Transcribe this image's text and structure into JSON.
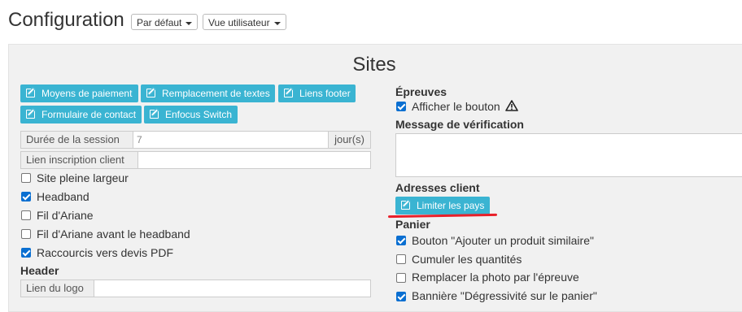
{
  "header": {
    "title": "Configuration",
    "dropdown_default": "Par défaut",
    "dropdown_user": "Vue utilisateur"
  },
  "panel": {
    "title": "Sites"
  },
  "buttons": [
    "Moyens de paiement",
    "Remplacement de textes",
    "Liens footer",
    "Formulaire de contact",
    "Enfocus Switch"
  ],
  "session": {
    "label": "Durée de la session",
    "value": "7",
    "unit": "jour(s)"
  },
  "inscription": {
    "label": "Lien inscription client",
    "value": ""
  },
  "left_checkboxes": [
    {
      "label": "Site pleine largeur",
      "checked": false
    },
    {
      "label": "Headband",
      "checked": true
    },
    {
      "label": "Fil d'Ariane",
      "checked": false
    },
    {
      "label": "Fil d'Ariane avant le headband",
      "checked": false
    },
    {
      "label": "Raccourcis vers devis PDF",
      "checked": true
    }
  ],
  "header_section": {
    "title": "Header",
    "logo_label": "Lien du logo",
    "logo_value": ""
  },
  "epreuves": {
    "title": "Épreuves",
    "show_button_label": "Afficher le bouton",
    "show_button_checked": true,
    "warning_icon": "warning-icon"
  },
  "message": {
    "title": "Message de vérification",
    "value": ""
  },
  "adresses": {
    "title": "Adresses client",
    "button": "Limiter les pays"
  },
  "panier": {
    "title": "Panier",
    "items": [
      {
        "label": "Bouton \"Ajouter un produit similaire\"",
        "checked": true
      },
      {
        "label": "Cumuler les quantités",
        "checked": false
      },
      {
        "label": "Remplacer la photo par l'épreuve",
        "checked": false
      },
      {
        "label": "Bannière \"Dégressivité sur le panier\"",
        "checked": true
      }
    ]
  },
  "colors": {
    "accent": "#3ab4d2",
    "checkbox": "#0a6fd1",
    "annotation": "#e8202a"
  }
}
